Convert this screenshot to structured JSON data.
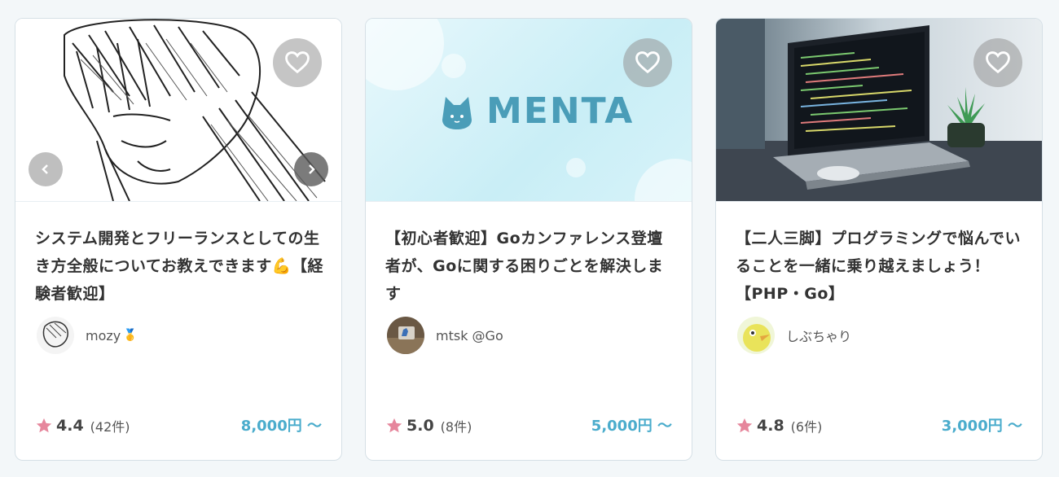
{
  "cards": [
    {
      "title": "システム開発とフリーランスとしての生き方全般についてお教えできます💪【経験者歓迎】",
      "mentor_name": "mozy",
      "badge": "🥇",
      "rating": "4.4",
      "review_count": "(42件)",
      "price": "8,000円 〜"
    },
    {
      "title": "【初心者歓迎】Goカンファレンス登壇者が、Goに関する困りごとを解決します",
      "thumb_logo": "MENTA",
      "mentor_name": "mtsk @Go",
      "rating": "5.0",
      "review_count": "(8件)",
      "price": "5,000円 〜"
    },
    {
      "title": "【二人三脚】プログラミングで悩んでいることを一緒に乗り越えましょう！【PHP・Go】",
      "mentor_name": "しぶちゃり",
      "rating": "4.8",
      "review_count": "(6件)",
      "price": "3,000円 〜"
    }
  ],
  "colors": {
    "accent": "#4aaccc",
    "star": "#e6869c",
    "menta_text": "#4a9db8"
  },
  "icons": [
    "heart-outline-icon",
    "chevron-left-icon",
    "chevron-right-icon",
    "star-icon"
  ]
}
